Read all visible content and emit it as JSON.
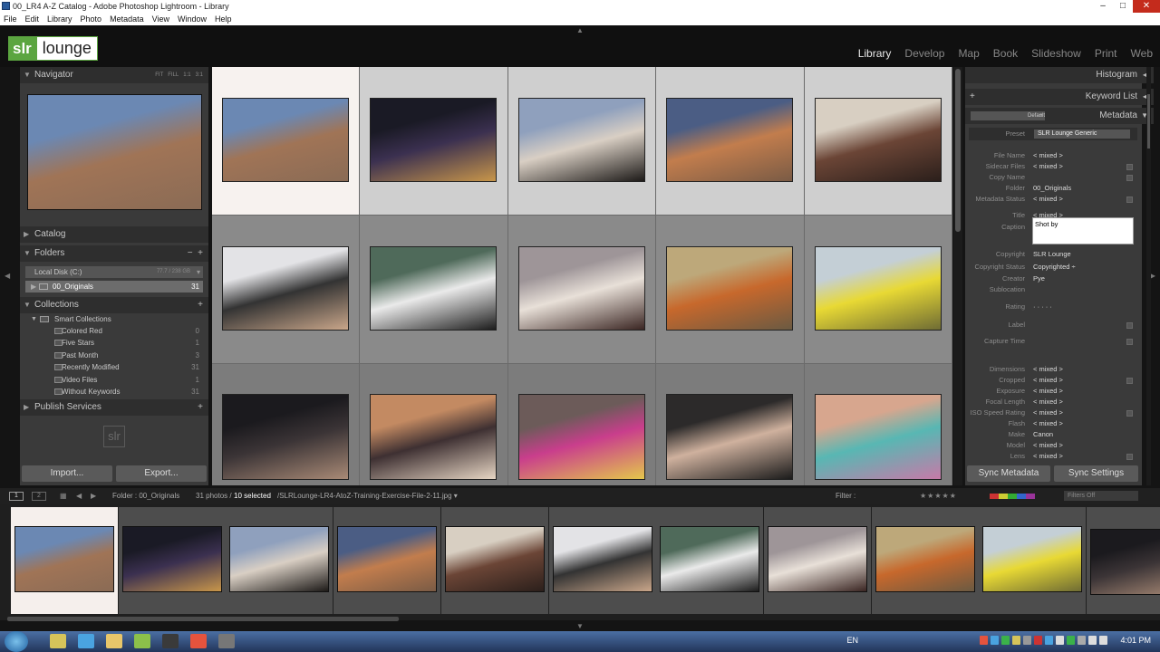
{
  "window": {
    "title": "00_LR4 A-Z Catalog - Adobe Photoshop Lightroom - Library",
    "controls": [
      "–",
      "□",
      "✕"
    ]
  },
  "menu": [
    "File",
    "Edit",
    "Library",
    "Photo",
    "Metadata",
    "View",
    "Window",
    "Help"
  ],
  "logo": {
    "left": "slr",
    "right": "lounge"
  },
  "modules": [
    {
      "label": "Library",
      "active": true
    },
    {
      "label": "Develop",
      "active": false
    },
    {
      "label": "Map",
      "active": false
    },
    {
      "label": "Book",
      "active": false
    },
    {
      "label": "Slideshow",
      "active": false
    },
    {
      "label": "Print",
      "active": false
    },
    {
      "label": "Web",
      "active": false
    }
  ],
  "left_panel": {
    "navigator": {
      "title": "Navigator",
      "zoom": [
        "FIT",
        "FILL",
        "1:1",
        "3:1"
      ]
    },
    "catalog": "Catalog",
    "folders": {
      "title": "Folders",
      "disk": {
        "name": "Local Disk (C:)",
        "space": "77.7 / 238 GB"
      },
      "folder": {
        "name": "00_Originals",
        "count": "31"
      }
    },
    "collections": {
      "title": "Collections",
      "smart": "Smart Collections",
      "items": [
        {
          "name": "Colored Red",
          "count": "0"
        },
        {
          "name": "Five Stars",
          "count": "1"
        },
        {
          "name": "Past Month",
          "count": "3"
        },
        {
          "name": "Recently Modified",
          "count": "31"
        },
        {
          "name": "Video Files",
          "count": "1"
        },
        {
          "name": "Without Keywords",
          "count": "31"
        }
      ]
    },
    "publish": "Publish Services",
    "watermark": "slr",
    "import": "Import...",
    "export": "Export..."
  },
  "grid": {
    "selected_index": 0,
    "thumbs": [
      {
        "colors": [
          "#6b88b3",
          "#a07456",
          "#8a6b55"
        ],
        "desc": "rusty-car"
      },
      {
        "colors": [
          "#1a1a25",
          "#3b3050",
          "#c8964a"
        ],
        "desc": "concert-crowd"
      },
      {
        "colors": [
          "#8fa0bd",
          "#d9cfc4",
          "#1d1a18"
        ],
        "desc": "cliff-sunset"
      },
      {
        "colors": [
          "#4b5d84",
          "#c27d4d",
          "#7a5b45"
        ],
        "desc": "coast-cliffs"
      },
      {
        "colors": [
          "#d8cfc2",
          "#6b4536",
          "#2b1f1b"
        ],
        "desc": "portrait-couple"
      },
      {
        "colors": [
          "#e3e3e6",
          "#333",
          "#c9a68a"
        ],
        "desc": "man-in-car"
      },
      {
        "colors": [
          "#4f6a5a",
          "#eaeaea",
          "#1c1c1c"
        ],
        "desc": "wedding-veil"
      },
      {
        "colors": [
          "#9e9598",
          "#e8e0d8",
          "#3a2522"
        ],
        "desc": "wedding-bike"
      },
      {
        "colors": [
          "#bda87a",
          "#c7682c",
          "#6b5a42"
        ],
        "desc": "monk-market"
      },
      {
        "colors": [
          "#c4cfd6",
          "#e8d934",
          "#6f6c34"
        ],
        "desc": "couple-flowers"
      },
      {
        "colors": [
          "#1b1a1e",
          "#3b3436",
          "#a98a76"
        ],
        "desc": "couple-kiss"
      },
      {
        "colors": [
          "#c38a62",
          "#3e3032",
          "#e7d6c4"
        ],
        "desc": "wedding-dance"
      },
      {
        "colors": [
          "#6c5b59",
          "#c93e8c",
          "#e4c74c"
        ],
        "desc": "woman-beach"
      },
      {
        "colors": [
          "#2c2a2a",
          "#cfb19e",
          "#1b1b1b"
        ],
        "desc": "man-portrait"
      },
      {
        "colors": [
          "#d7a68e",
          "#58b7b3",
          "#c77aa8"
        ],
        "desc": "party-dancing"
      }
    ]
  },
  "right_panel": {
    "histogram": "Histogram",
    "keyword_list": "Keyword List",
    "metadata": {
      "title": "Metadata",
      "default": "Default",
      "preset_label": "Preset",
      "preset_value": "SLR Lounge Generic",
      "fields": [
        {
          "label": "File Name",
          "value": "< mixed >"
        },
        {
          "label": "Sidecar Files",
          "value": "< mixed >"
        },
        {
          "label": "Copy Name",
          "value": ""
        },
        {
          "label": "Folder",
          "value": "00_Originals"
        },
        {
          "label": "Metadata Status",
          "value": "< mixed >"
        },
        {
          "label": "Title",
          "value": "< mixed >"
        },
        {
          "label": "Caption",
          "value": "Shot by"
        },
        {
          "label": "Copyright",
          "value": "SLR Lounge"
        },
        {
          "label": "Copyright Status",
          "value": "Copyrighted ÷"
        },
        {
          "label": "Creator",
          "value": "Pye"
        },
        {
          "label": "Sublocation",
          "value": ""
        },
        {
          "label": "Rating",
          "value": "·   ·   ·   ·   ·"
        },
        {
          "label": "Label",
          "value": ""
        },
        {
          "label": "Capture Time",
          "value": ""
        },
        {
          "label": "Dimensions",
          "value": "< mixed >"
        },
        {
          "label": "Cropped",
          "value": "< mixed >"
        },
        {
          "label": "Exposure",
          "value": "< mixed >"
        },
        {
          "label": "Focal Length",
          "value": "< mixed >"
        },
        {
          "label": "ISO Speed Rating",
          "value": "< mixed >"
        },
        {
          "label": "Flash",
          "value": "< mixed >"
        },
        {
          "label": "Make",
          "value": "Canon"
        },
        {
          "label": "Model",
          "value": "< mixed >"
        },
        {
          "label": "Lens",
          "value": "< mixed >"
        }
      ]
    },
    "sync_metadata": "Sync Metadata",
    "sync_settings": "Sync Settings"
  },
  "filmstrip_bar": {
    "page1": "1",
    "page2": "2",
    "path_prefix": "Folder : 00_Originals",
    "count_text": "31 photos /",
    "selected_text": "10 selected",
    "file_text": "/SLRLounge-LR4-AtoZ-Training-Exercise-File-2-11.jpg ▾",
    "filter_label": "Filter :",
    "filter_value": "Filters Off"
  },
  "filmstrip": [
    {
      "colors": [
        "#6b88b3",
        "#a07456",
        "#8a6b55"
      ]
    },
    {
      "colors": [
        "#1a1a25",
        "#3b3050",
        "#c8964a"
      ]
    },
    {
      "colors": [
        "#8fa0bd",
        "#d9cfc4",
        "#1d1a18"
      ]
    },
    {
      "colors": [
        "#4b5d84",
        "#c27d4d",
        "#7a5b45"
      ]
    },
    {
      "colors": [
        "#d8cfc2",
        "#6b4536",
        "#2b1f1b"
      ]
    },
    {
      "colors": [
        "#e3e3e6",
        "#333",
        "#c9a68a"
      ]
    },
    {
      "colors": [
        "#4f6a5a",
        "#eaeaea",
        "#1c1c1c"
      ]
    },
    {
      "colors": [
        "#9e9598",
        "#e8e0d8",
        "#3a2522"
      ]
    },
    {
      "colors": [
        "#bda87a",
        "#c7682c",
        "#6b5a42"
      ]
    },
    {
      "colors": [
        "#c4cfd6",
        "#e8d934",
        "#6f6c34"
      ]
    },
    {
      "colors": [
        "#1b1a1e",
        "#3b3436",
        "#a98a76"
      ]
    }
  ],
  "taskbar": {
    "lang": "EN",
    "time": "4:01 PM",
    "apps": [
      {
        "color": "#d6c45a"
      },
      {
        "color": "#4aa3e0"
      },
      {
        "color": "#e8c66a"
      },
      {
        "color": "#8cc04a"
      },
      {
        "color": "#3a3a3a"
      },
      {
        "color": "#e5533d"
      },
      {
        "color": "#777"
      }
    ]
  }
}
